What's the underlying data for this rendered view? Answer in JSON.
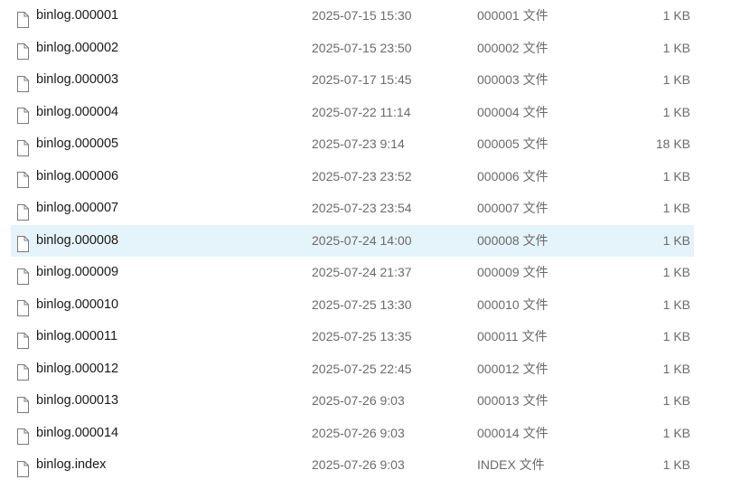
{
  "files": [
    {
      "name": "binlog.000001",
      "date": "2025-07-15 15:30",
      "type": "000001 文件",
      "size": "1 KB",
      "selected": false
    },
    {
      "name": "binlog.000002",
      "date": "2025-07-15 23:50",
      "type": "000002 文件",
      "size": "1 KB",
      "selected": false
    },
    {
      "name": "binlog.000003",
      "date": "2025-07-17 15:45",
      "type": "000003 文件",
      "size": "1 KB",
      "selected": false
    },
    {
      "name": "binlog.000004",
      "date": "2025-07-22 11:14",
      "type": "000004 文件",
      "size": "1 KB",
      "selected": false
    },
    {
      "name": "binlog.000005",
      "date": "2025-07-23 9:14",
      "type": "000005 文件",
      "size": "18 KB",
      "selected": false
    },
    {
      "name": "binlog.000006",
      "date": "2025-07-23 23:52",
      "type": "000006 文件",
      "size": "1 KB",
      "selected": false
    },
    {
      "name": "binlog.000007",
      "date": "2025-07-23 23:54",
      "type": "000007 文件",
      "size": "1 KB",
      "selected": false
    },
    {
      "name": "binlog.000008",
      "date": "2025-07-24 14:00",
      "type": "000008 文件",
      "size": "1 KB",
      "selected": true
    },
    {
      "name": "binlog.000009",
      "date": "2025-07-24 21:37",
      "type": "000009 文件",
      "size": "1 KB",
      "selected": false
    },
    {
      "name": "binlog.000010",
      "date": "2025-07-25 13:30",
      "type": "000010 文件",
      "size": "1 KB",
      "selected": false
    },
    {
      "name": "binlog.000011",
      "date": "2025-07-25 13:35",
      "type": "000011 文件",
      "size": "1 KB",
      "selected": false
    },
    {
      "name": "binlog.000012",
      "date": "2025-07-25 22:45",
      "type": "000012 文件",
      "size": "1 KB",
      "selected": false
    },
    {
      "name": "binlog.000013",
      "date": "2025-07-26 9:03",
      "type": "000013 文件",
      "size": "1 KB",
      "selected": false
    },
    {
      "name": "binlog.000014",
      "date": "2025-07-26 9:03",
      "type": "000014 文件",
      "size": "1 KB",
      "selected": false
    },
    {
      "name": "binlog.index",
      "date": "2025-07-26 9:03",
      "type": "INDEX 文件",
      "size": "1 KB",
      "selected": false
    }
  ],
  "icons": {
    "file": "blank-file-icon"
  },
  "colors": {
    "selected_row": "#e5f3fb"
  }
}
